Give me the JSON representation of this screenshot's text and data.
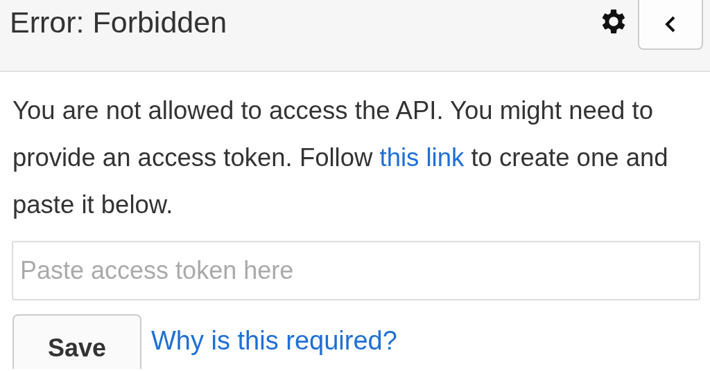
{
  "header": {
    "title": "Error: Forbidden"
  },
  "message": {
    "before": "You are not allowed to access the API. You might need to provide an access token. Follow",
    "link": "this link",
    "after": "to create one and paste it below."
  },
  "token_field": {
    "placeholder": "Paste access token here"
  },
  "save_button": {
    "label": "Save"
  },
  "help_link": {
    "label": "Why is this required?"
  }
}
